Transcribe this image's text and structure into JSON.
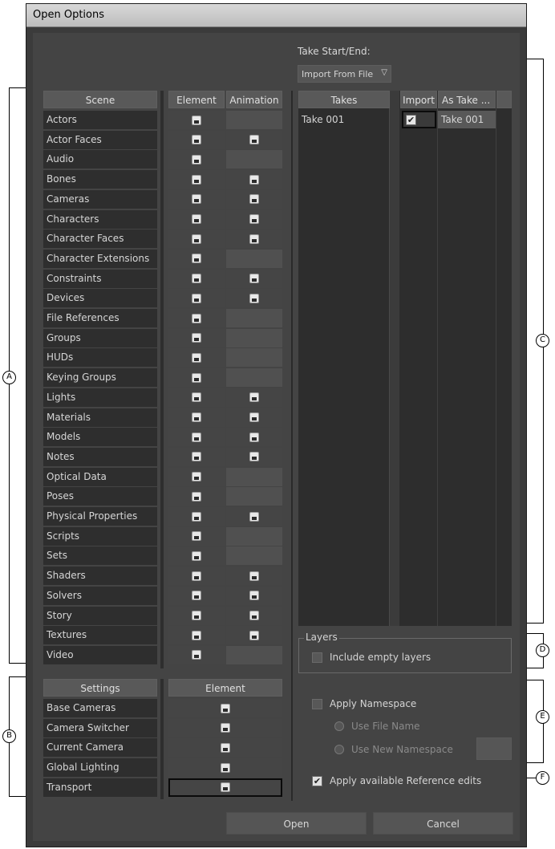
{
  "title": "Open Options",
  "take_start_end_label": "Take Start/End:",
  "take_dropdown_value": "Import From File",
  "scene_table": {
    "headers": {
      "scene": "Scene",
      "element": "Element",
      "animation": "Animation"
    },
    "rows": [
      {
        "label": "Actors",
        "element": true,
        "animation": false
      },
      {
        "label": "Actor Faces",
        "element": true,
        "animation": true
      },
      {
        "label": "Audio",
        "element": true,
        "animation": false
      },
      {
        "label": "Bones",
        "element": true,
        "animation": true
      },
      {
        "label": "Cameras",
        "element": true,
        "animation": true
      },
      {
        "label": "Characters",
        "element": true,
        "animation": true
      },
      {
        "label": "Character Faces",
        "element": true,
        "animation": true
      },
      {
        "label": "Character Extensions",
        "element": true,
        "animation": false
      },
      {
        "label": "Constraints",
        "element": true,
        "animation": true
      },
      {
        "label": "Devices",
        "element": true,
        "animation": true
      },
      {
        "label": "File References",
        "element": true,
        "animation": false
      },
      {
        "label": "Groups",
        "element": true,
        "animation": false
      },
      {
        "label": "HUDs",
        "element": true,
        "animation": false
      },
      {
        "label": "Keying Groups",
        "element": true,
        "animation": false
      },
      {
        "label": "Lights",
        "element": true,
        "animation": true
      },
      {
        "label": "Materials",
        "element": true,
        "animation": true
      },
      {
        "label": "Models",
        "element": true,
        "animation": true
      },
      {
        "label": "Notes",
        "element": true,
        "animation": true
      },
      {
        "label": "Optical Data",
        "element": true,
        "animation": false
      },
      {
        "label": "Poses",
        "element": true,
        "animation": false
      },
      {
        "label": "Physical Properties",
        "element": true,
        "animation": true
      },
      {
        "label": "Scripts",
        "element": true,
        "animation": false
      },
      {
        "label": "Sets",
        "element": true,
        "animation": false
      },
      {
        "label": "Shaders",
        "element": true,
        "animation": true
      },
      {
        "label": "Solvers",
        "element": true,
        "animation": true
      },
      {
        "label": "Story",
        "element": true,
        "animation": true
      },
      {
        "label": "Textures",
        "element": true,
        "animation": true
      },
      {
        "label": "Video",
        "element": true,
        "animation": false
      }
    ]
  },
  "settings_table": {
    "headers": {
      "settings": "Settings",
      "element": "Element"
    },
    "rows": [
      {
        "label": "Base Cameras"
      },
      {
        "label": "Camera Switcher"
      },
      {
        "label": "Current Camera"
      },
      {
        "label": "Global Lighting"
      },
      {
        "label": "Transport"
      }
    ]
  },
  "takes_table": {
    "headers": {
      "takes": "Takes",
      "import": "Import",
      "as_take": "As Take ..."
    },
    "rows": [
      {
        "take": "Take 001",
        "import": true,
        "as_take": "Take 001"
      }
    ]
  },
  "layers": {
    "group_label": "Layers",
    "include_empty_label": "Include empty layers",
    "include_empty_checked": false
  },
  "namespace": {
    "apply_label": "Apply Namespace",
    "apply_checked": false,
    "use_file_name_label": "Use File Name",
    "use_new_namespace_label": "Use New Namespace"
  },
  "reference_edits": {
    "label": "Apply available Reference edits",
    "checked": true
  },
  "buttons": {
    "open": "Open",
    "cancel": "Cancel"
  },
  "callouts": {
    "a": "A",
    "b": "B",
    "c": "C",
    "d": "D",
    "e": "E",
    "f": "F"
  }
}
